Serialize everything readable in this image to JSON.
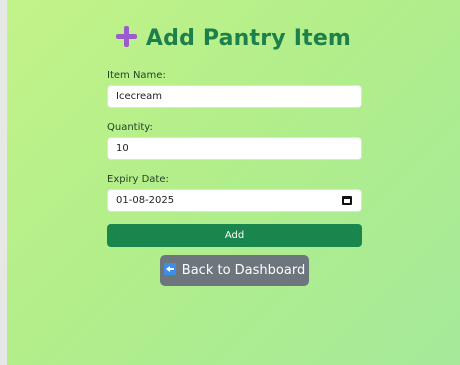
{
  "header": {
    "title": "Add Pantry Item",
    "icon": "plus-icon",
    "icon_color": "#9a5ccd",
    "title_color": "#1d7f4c"
  },
  "form": {
    "item_name": {
      "label": "Item Name:",
      "value": "Icecream"
    },
    "quantity": {
      "label": "Quantity:",
      "value": "10"
    },
    "expiry_date": {
      "label": "Expiry Date:",
      "value": "01-08-2025",
      "icon": "calendar-icon"
    },
    "submit_label": "Add",
    "submit_color": "#19864e"
  },
  "nav": {
    "back_label": "Back to Dashboard",
    "back_icon": "back-arrow-icon",
    "back_color": "#6d757d"
  }
}
